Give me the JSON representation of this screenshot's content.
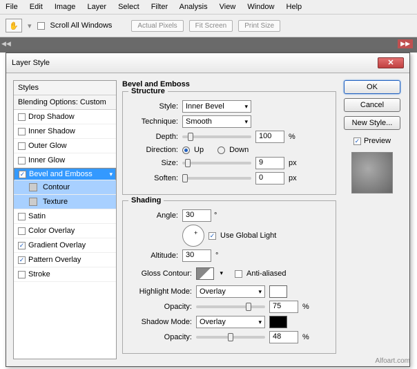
{
  "menu": [
    "File",
    "Edit",
    "Image",
    "Layer",
    "Select",
    "Filter",
    "Analysis",
    "View",
    "Window",
    "Help"
  ],
  "toolbar": {
    "scroll_all": "Scroll All Windows",
    "b1": "Actual Pixels",
    "b2": "Fit Screen",
    "b3": "Print Size"
  },
  "dialog": {
    "title": "Layer Style",
    "styles_hdr": "Styles",
    "blend_hdr": "Blending Options: Custom",
    "rows": {
      "drop": "Drop Shadow",
      "inner_shadow": "Inner Shadow",
      "outer_glow": "Outer Glow",
      "inner_glow": "Inner Glow",
      "bevel": "Bevel and Emboss",
      "contour": "Contour",
      "texture": "Texture",
      "satin": "Satin",
      "color_ov": "Color Overlay",
      "grad_ov": "Gradient Overlay",
      "pat_ov": "Pattern Overlay",
      "stroke": "Stroke"
    },
    "section_title": "Bevel and Emboss",
    "structure": {
      "legend": "Structure",
      "style_lbl": "Style:",
      "style_val": "Inner Bevel",
      "tech_lbl": "Technique:",
      "tech_val": "Smooth",
      "depth_lbl": "Depth:",
      "depth_val": "100",
      "pct": "%",
      "dir_lbl": "Direction:",
      "up": "Up",
      "down": "Down",
      "size_lbl": "Size:",
      "size_val": "9",
      "px": "px",
      "soften_lbl": "Soften:",
      "soften_val": "0"
    },
    "shading": {
      "legend": "Shading",
      "angle_lbl": "Angle:",
      "angle_val": "30",
      "deg": "°",
      "global": "Use Global Light",
      "alt_lbl": "Altitude:",
      "alt_val": "30",
      "gloss_lbl": "Gloss Contour:",
      "aa": "Anti-aliased",
      "hmode_lbl": "Highlight Mode:",
      "hmode_val": "Overlay",
      "opacity_lbl": "Opacity:",
      "hop_val": "75",
      "smode_lbl": "Shadow Mode:",
      "smode_val": "Overlay",
      "sop_val": "48",
      "pct": "%"
    },
    "buttons": {
      "ok": "OK",
      "cancel": "Cancel",
      "new_style": "New Style...",
      "preview": "Preview"
    }
  },
  "watermark": "Alfoart.com"
}
